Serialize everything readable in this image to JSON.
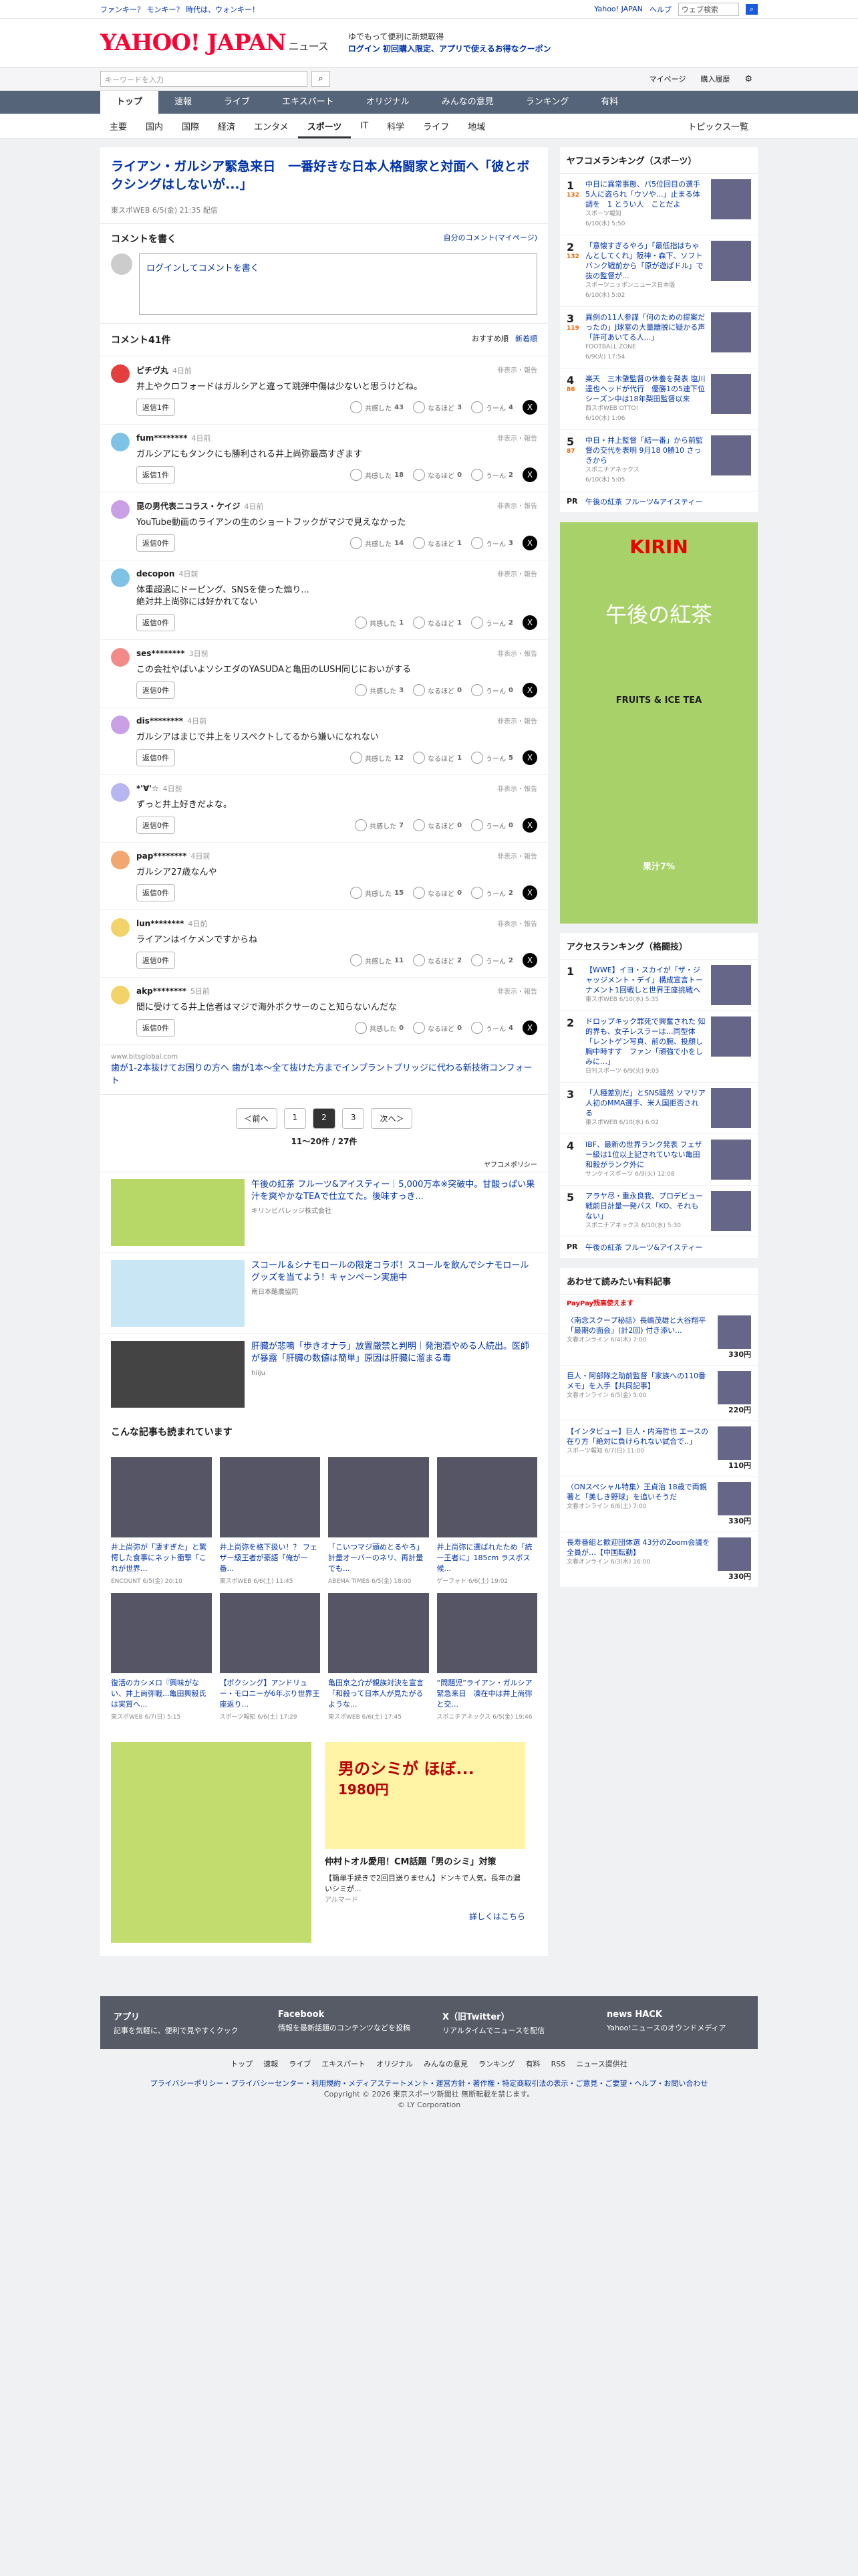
{
  "util": {
    "left": "ファンキー？ モンキー？ 時代は、ウォンキー！",
    "links": [
      "Yahoo! JAPAN",
      "ヘルプ"
    ],
    "search_placeholder": "ウェブ検索"
  },
  "header": {
    "logo": "YAHOO! JAPAN",
    "section": "ニュース",
    "promo1": "ゆでもって便利に新規取得",
    "promo2": "ログイン 初回購入限定、アプリで使えるお得なクーポン"
  },
  "search": {
    "placeholder": "キーワードを入力",
    "mypage": "マイページ",
    "history": "購入履歴"
  },
  "gnav": [
    "トップ",
    "速報",
    "ライブ",
    "エキスパート",
    "オリジナル",
    "みんなの意見",
    "ランキング",
    "有料"
  ],
  "snav": [
    "主要",
    "国内",
    "国際",
    "経済",
    "エンタメ",
    "スポーツ",
    "IT",
    "科学",
    "ライフ",
    "地域"
  ],
  "snav_right": "トピックス一覧",
  "article": {
    "title": "ライアン・ガルシア緊急来日　一番好きな日本人格闘家と対面へ「彼とボクシングはしないが...」",
    "meta": "東スポWEB 6/5(金) 21:35 配信"
  },
  "compose": {
    "heading": "コメントを書く",
    "mine": "自分のコメント(マイページ)",
    "placeholder": "ログインしてコメントを書く"
  },
  "comments_header": {
    "title": "コメント41件",
    "sort1": "おすすめ順",
    "sort2": "新着順"
  },
  "comments": [
    {
      "user": "ピチヴ丸",
      "time": "4日前",
      "text": "井上やクロフォードはガルシアと違って跳弾中傷は少ないと思うけどね。",
      "reply": "返信1件",
      "c1": "43",
      "c2": "3",
      "c3": "4",
      "color": "#e53e3e"
    },
    {
      "user": "fum********",
      "time": "4日前",
      "text": "ガルシアにもタンクにも勝利される井上尚弥最高すぎます",
      "reply": "返信1件",
      "c1": "18",
      "c2": "0",
      "c3": "2",
      "color": "#7ec3e6"
    },
    {
      "user": "昆の男代表ニコラス・ケイジ",
      "time": "4日前",
      "text": "YouTube動画のライアンの生のショートフックがマジで見えなかった",
      "reply": "返信0件",
      "c1": "14",
      "c2": "1",
      "c3": "3",
      "color": "#c9a0e6"
    },
    {
      "user": "decopon",
      "time": "4日前",
      "text": "体重超過にドーピング、SNSを使った煽り...\n絶対井上尚弥には好かれてない",
      "reply": "返信0件",
      "c1": "1",
      "c2": "1",
      "c3": "2",
      "color": "#7ec3e6"
    },
    {
      "user": "ses********",
      "time": "3日前",
      "text": "この会社やばいよソシエダのYASUDAと亀田のLUSH同じにおいがする",
      "reply": "返信0件",
      "c1": "3",
      "c2": "0",
      "c3": "0",
      "color": "#f28a8a"
    },
    {
      "user": "dis********",
      "time": "4日前",
      "text": "ガルシアはまじで井上をリスペクトしてるから嫌いになれない",
      "reply": "返信0件",
      "c1": "12",
      "c2": "1",
      "c3": "5",
      "color": "#c9a0e6"
    },
    {
      "user": "*'∀'☆",
      "time": "4日前",
      "text": "ずっと井上好きだよな。",
      "reply": "返信0件",
      "c1": "7",
      "c2": "0",
      "c3": "0",
      "color": "#b6b6f0"
    },
    {
      "user": "pap********",
      "time": "4日前",
      "text": "ガルシア27歳なんや",
      "reply": "返信0件",
      "c1": "15",
      "c2": "0",
      "c3": "2",
      "color": "#f2a670"
    },
    {
      "user": "lun********",
      "time": "4日前",
      "text": "ライアンはイケメンですからね",
      "reply": "返信0件",
      "c1": "11",
      "c2": "2",
      "c3": "2",
      "color": "#f2d36a"
    },
    {
      "user": "akp********",
      "time": "5日前",
      "text": "間に受けてる井上信者はマジで海外ボクサーのこと知らないんだな",
      "reply": "返信0件",
      "c1": "0",
      "c2": "0",
      "c3": "4",
      "color": "#f2d36a"
    }
  ],
  "reaction_labels": [
    "共感した",
    "なるほど",
    "うーん"
  ],
  "report": "非表示・報告",
  "inline_ad": {
    "domain": "www.bitsglobal.com",
    "text": "歯が1-2本抜けてお困りの方へ 歯が1本〜全て抜けた方までインプラントブリッジに代わる新技術コンフォート"
  },
  "pager": {
    "prev": "＜前へ",
    "pages": [
      "1",
      "2",
      "3"
    ],
    "next": "次へ＞",
    "count": "11〜20件 / 27件"
  },
  "yahoo_policy": "ヤフコメポリシー",
  "ads": [
    {
      "title": "午後の紅茶 フルーツ&アイスティー｜5,000万本※突破中。甘酸っぱい果汁を爽やかなTEAで仕立てた。後味すっき...",
      "src": "キリンビバレッジ株式会社",
      "color": "#b7d766"
    },
    {
      "title": "スコール＆シナモロールの限定コラボ！スコールを飲んでシナモロール グッズを当てよう！キャンペーン実施中",
      "src": "南日本酪農協同",
      "color": "#c9e6f5"
    },
    {
      "title": "肝臓が悲鳴「歩きオナラ」放置厳禁と判明｜発泡酒やめる人続出。医師が暴露「肝臓の数値は簡単」原因は肝臓に溜まる毒",
      "src": "hiiju",
      "color": "#444"
    }
  ],
  "related_heading": "こんな記事も読まれています",
  "related": [
    {
      "title": "井上尚弥が「凄すぎた」と驚愕した食事にネット衝撃「これが世界...",
      "src": "ENCOUNT",
      "date": "6/5(金) 20:10"
    },
    {
      "title": "井上尚弥を格下扱い！？ フェザー級王者が豪語「俺が一番...",
      "src": "東スポWEB",
      "date": "6/6(土) 11:45"
    },
    {
      "title": "「こいつマジ頭めとるやろ」計量オーバーのネリ、再計量でも...",
      "src": "ABEMA TIMES",
      "date": "6/5(金) 18:00"
    },
    {
      "title": "井上尚弥に選ばれたため「統一王者に」185cm ラスボス候...",
      "src": "ゲーフォト",
      "date": "6/6(土) 19:02"
    },
    {
      "title": "復活のカシメロ『興味がない、井上尚弥戦...亀田興毅氏は実質へ...",
      "src": "東スポWEB",
      "date": "6/7(日) 5:15"
    },
    {
      "title": "【ボクシング】アンドリュー・モロニーが6年ぶり世界王座返り...",
      "src": "スポーツ報知",
      "date": "6/6(土) 17:29"
    },
    {
      "title": "亀田京之介が親族対決を宣言「和殺って日本人が見たがるような...",
      "src": "東スポWEB",
      "date": "6/6(土) 17:45"
    },
    {
      "title": "“問題児”ライアン・ガルシア緊急来日　凍在中は井上尚弥と交...",
      "src": "スポニチアネックス",
      "date": "6/5(金) 19:46"
    }
  ],
  "bottom_ad": {
    "title": "仲村トオル愛用！CM話題「男のシミ」対策",
    "body": "【簡単手続きで2回目送りません】ドンキで人気。長年の濃いシミが...",
    "src": "アルマード",
    "link": "詳しくはこちら",
    "ad_headline": "男のシミが ほぼ...",
    "price": "1980円"
  },
  "side_ranking": {
    "title": "ヤフコメランキング（スポーツ）",
    "items": [
      {
        "n": "1",
        "cnt": "132",
        "title": "中日に異常事態、パ5位回目の選手 5人に盗られ「ウソや...」止まる体調を　1 とうい人　ことだよ",
        "src": "スポーツ報知",
        "date": "6/10(水) 5:50"
      },
      {
        "n": "2",
        "cnt": "132",
        "title": "「意懐すぎるやろ」「最低指はちゃんとしてくれ」阪神・森下、ソフトバンク戦前から「原が遊ばドル」で抜の監督が...",
        "src": "スポーツニッポンニュース日本版",
        "date": "6/10(水) 5:02"
      },
      {
        "n": "3",
        "cnt": "119",
        "title": "異例の11人参謀「何のための提案だったの」J球室の大量離脱に疑かる声「許可あいてる人...」",
        "src": "FOOTBALL ZONE",
        "date": "6/9(火) 17:54"
      },
      {
        "n": "4",
        "cnt": "86",
        "title": "楽天　三木肇監督の休養を発表 塩川達也ヘッドが代行　優勝1の5連下位　シーズン中は18年梨田監督以来",
        "src": "西スポWEB OTTO!",
        "date": "6/10(水) 1:06"
      },
      {
        "n": "5",
        "cnt": "87",
        "title": "中日・井上監督「結一番」から前監督の交代を表明 9月18 0勝10 さっきから",
        "src": "スポニチアネックス",
        "date": "6/10(水) 5:05"
      }
    ],
    "pr": "午後の紅茶 フルーツ&アイスティー",
    "pr_src": "キリンビバレッジ株式会社"
  },
  "side_ad": {
    "brand": "KIRIN",
    "name": "午後の紅茶",
    "product": "FRUITS & ICE TEA",
    "juice": "果汁7%"
  },
  "access_ranking": {
    "title": "アクセスランキング（格闘技）",
    "items": [
      {
        "n": "1",
        "title": "【WWE】イヨ・スカイが「ザ・ジャッジメント・デイ」構成宣言トーナメント1回戦しと世界王座挑戦へ",
        "src": "東スポWEB",
        "date": "6/10(水) 5:35"
      },
      {
        "n": "2",
        "title": "ドロップキック罪死で興奮された 知的界も、女子レスラーは…同型体「レントゲン写真、前の腕、投顔し胸中時すす　ファン「頑強で小をしみに…」",
        "src": "日刊スポーツ",
        "date": "6/9(火) 9:03"
      },
      {
        "n": "3",
        "title": "「人種差別だ」とSNS騒然 ソマリア人初のMMA選手、米人国拒否される",
        "src": "東スポWEB",
        "date": "6/10(水) 6:02"
      },
      {
        "n": "4",
        "title": "IBF、最新の世界ランク発表 フェザー級は1位以上記されていない亀田和毅がランク外に",
        "src": "サンケイスポーツ",
        "date": "6/9(火) 12:08"
      },
      {
        "n": "5",
        "title": "アラヤ尽・重永良我、プロデビュー戦前日計量一発パス「KO、それもない」",
        "src": "スポニチアネックス",
        "date": "6/10(水) 5:30"
      }
    ],
    "pr": "午後の紅茶 フルーツ&アイスティー",
    "pr_src": "キリンビバレッジ株式会社"
  },
  "paid": {
    "title": "あわせて読みたい有料記事",
    "badge": "PayPay残高使えます",
    "items": [
      {
        "title": "〈南念スクープ秘話〉長嶋茂雄と大谷翔平「最期の面会」(計2回) 付き添い...",
        "src": "文春オンライン",
        "date": "6/4(木) 7:00",
        "price": "330円"
      },
      {
        "title": "巨人・阿部隊之助前監督「家族への110番メモ」を入手【共同記事】",
        "src": "文春オンライン",
        "date": "6/5(金) 5:00",
        "price": "220円"
      },
      {
        "title": "【インタビュー】巨人・内海哲也 エースの在り方「絶対に負けられない試合で..」",
        "src": "スポーツ報知",
        "date": "6/7(日) 11:00",
        "price": "110円"
      },
      {
        "title": "〈ONスペシャル特集〉王貞治 18歳で両親著と「美しき野球」を追いそうだ",
        "src": "文春オンライン",
        "date": "6/6(土) 7:00",
        "price": "330円"
      },
      {
        "title": "長寿番組と歓迎団体選 43分のZoom会議を全員が…【中国転勤】",
        "src": "文春オンライン",
        "date": "6/3(水) 16:00",
        "price": "330円"
      }
    ]
  },
  "footer": {
    "cols": [
      {
        "title": "アプリ",
        "text": "記事を気軽に、便利で見やすくクック"
      },
      {
        "title": "Facebook",
        "text": "情報を最新話題のコンテンツなどを投稿"
      },
      {
        "title": "X（旧Twitter）",
        "text": "リアルタイムでニュースを配信"
      },
      {
        "title": "news HACK",
        "text": "Yahoo!ニュースのオウンドメディア"
      }
    ],
    "links": [
      "トップ",
      "速報",
      "ライブ",
      "エキスパート",
      "オリジナル",
      "みんなの意見",
      "ランキング",
      "有料",
      "RSS",
      "ニュース提供社"
    ],
    "legal": "プライバシーポリシー・プライバシーセンター・利用規約・メディアステートメント・運営方針・著作権・特定商取引法の表示・ご意見・ご要望・ヘルプ・お問い合わせ",
    "copy1": "Copyright © 2026 東京スポーツ新聞社 無断転載を禁じます。",
    "copy2": "© LY Corporation"
  }
}
